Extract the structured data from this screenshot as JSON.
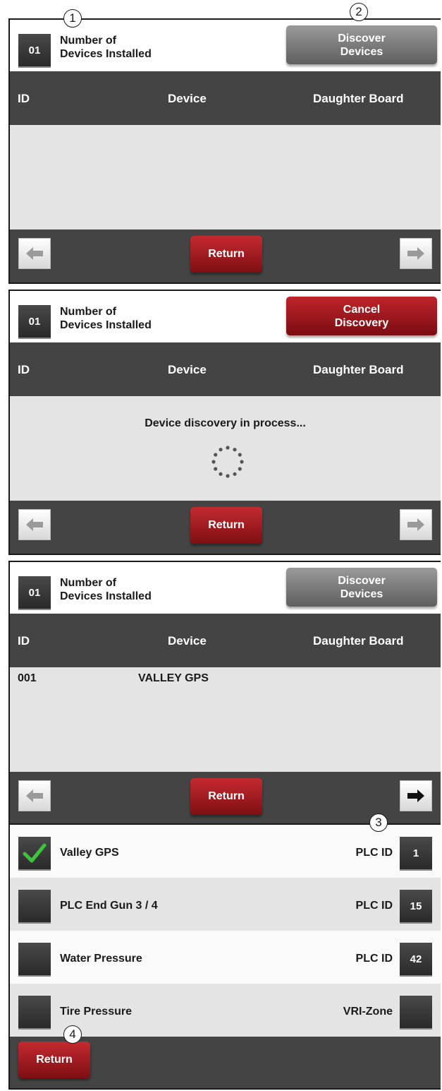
{
  "common": {
    "count_value": "01",
    "count_label_line1": "Number of",
    "count_label_line2": "Devices Installed",
    "col_id": "ID",
    "col_device": "Device",
    "col_daughter": "Daughter Board",
    "return_label": "Return"
  },
  "panel1": {
    "button_line1": "Discover",
    "button_line2": "Devices"
  },
  "panel2": {
    "button_line1": "Cancel",
    "button_line2": "Discovery",
    "message": "Device discovery in process..."
  },
  "panel3": {
    "button_line1": "Discover",
    "button_line2": "Devices",
    "rows": [
      {
        "id": "001",
        "device": "VALLEY GPS"
      }
    ]
  },
  "panel4": {
    "rows": [
      {
        "label": "Valley GPS",
        "checked": true,
        "right_label": "PLC ID",
        "value": "1"
      },
      {
        "label": "PLC End Gun 3 / 4",
        "checked": false,
        "right_label": "PLC ID",
        "value": "15"
      },
      {
        "label": "Water Pressure",
        "checked": false,
        "right_label": "PLC ID",
        "value": "42"
      },
      {
        "label": "Tire Pressure",
        "checked": false,
        "right_label": "VRI-Zone",
        "value": ""
      }
    ],
    "return_label": "Return"
  },
  "callouts": {
    "c1": "1",
    "c2": "2",
    "c3": "3",
    "c4": "4"
  },
  "colors": {
    "header_dark": "#444444",
    "button_red": "#a81c22",
    "button_gray": "#7a7a7a",
    "check_green": "#3cc43c"
  }
}
